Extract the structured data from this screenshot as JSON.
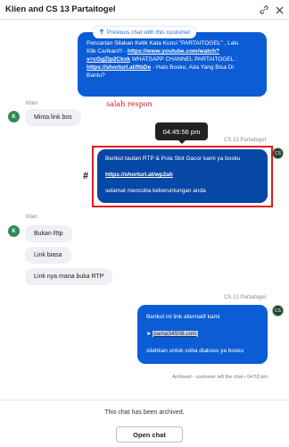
{
  "header": {
    "title": "Klien and CS 13 Partaitogel"
  },
  "previous_chat_link": "Previous chat with this customer",
  "top_message": {
    "line1": "Pencarian Silakan Ketik Kata Kunci \"PARTAITOGEL\" , Lalu",
    "line2_prefix": "Klik Carikan!!! - ",
    "youtube_link_part1": "https://www.youtube.com/watch?",
    "youtube_link_part2": "v=cGgZlp2Ckxk",
    "line3_suffix": " WHATSAPP CHANNEL PARTAITOGEL :",
    "shorturl_link": "https://shorturl.at/ftbDe",
    "line4_suffix": " - Halo Bosku, Ada Yang Bisa Di",
    "line5": "Bantu?"
  },
  "klien_group_1": {
    "sender": "Klien",
    "avatar_initial": "K",
    "messages": [
      "Minta link bos"
    ]
  },
  "annotation_red": "salah respon",
  "tooltip_time": "04:45:56 pm",
  "agent_group_1": {
    "sender": "CS 13 Partaitogel",
    "line1": "Berikut tautan RTP & Pola Slot Gacor kami ya bosku",
    "link": "https://shorturl.at/wp2ah",
    "line3": "selamat mencoba keberuntungan anda"
  },
  "hash_mark": "#",
  "klien_group_2": {
    "sender": "Klien",
    "avatar_initial": "K",
    "messages": [
      "Bukan Rtp",
      "Link biasa",
      "Link nya mana buka RTP"
    ]
  },
  "agent_group_2": {
    "sender": "CS 13 Partaitogel",
    "line1": "Berikut ini link alternatif kami",
    "arrow": "➤",
    "link": "partai34508.com",
    "line3": "silahkan untuk coba diakses ya bosku"
  },
  "archived_note": "Archived - customer left the chat • 04:53 pm",
  "footer": {
    "message": "This chat has been archived.",
    "open_button": "Open chat"
  },
  "colors": {
    "outgoing_bubble": "#0b5cd5",
    "highlighted_bubble": "#0747a6",
    "incoming_bubble": "#eef0f3",
    "annotation": "#d21a1a",
    "link_blue": "#2a6fdb"
  }
}
